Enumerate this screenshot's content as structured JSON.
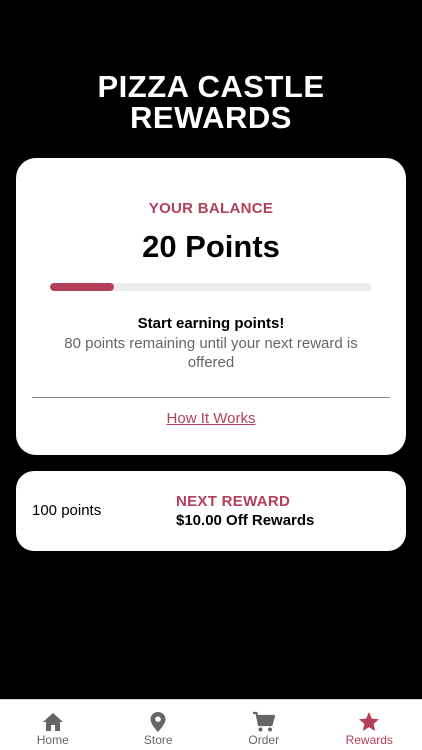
{
  "header": {
    "title_line1": "PIZZA CASTLE",
    "title_line2": "REWARDS"
  },
  "balance": {
    "label": "YOUR BALANCE",
    "value": "20 Points",
    "progress_fraction": 0.2,
    "earn_title": "Start earning points!",
    "earn_subtitle": "80 points remaining until your next reward is offered",
    "how_it_works": "How It Works"
  },
  "next_reward": {
    "points": "100 points",
    "label": "NEXT REWARD",
    "name": "$10.00 Off Rewards"
  },
  "tabs": [
    {
      "label": "Home",
      "icon": "home-icon"
    },
    {
      "label": "Store",
      "icon": "location-pin-icon"
    },
    {
      "label": "Order",
      "icon": "cart-icon"
    },
    {
      "label": "Rewards",
      "icon": "star-icon"
    }
  ],
  "active_tab": "Rewards",
  "colors": {
    "accent": "#b3405a",
    "background": "#000000",
    "card": "#ffffff",
    "inactive_tab": "#666666"
  }
}
